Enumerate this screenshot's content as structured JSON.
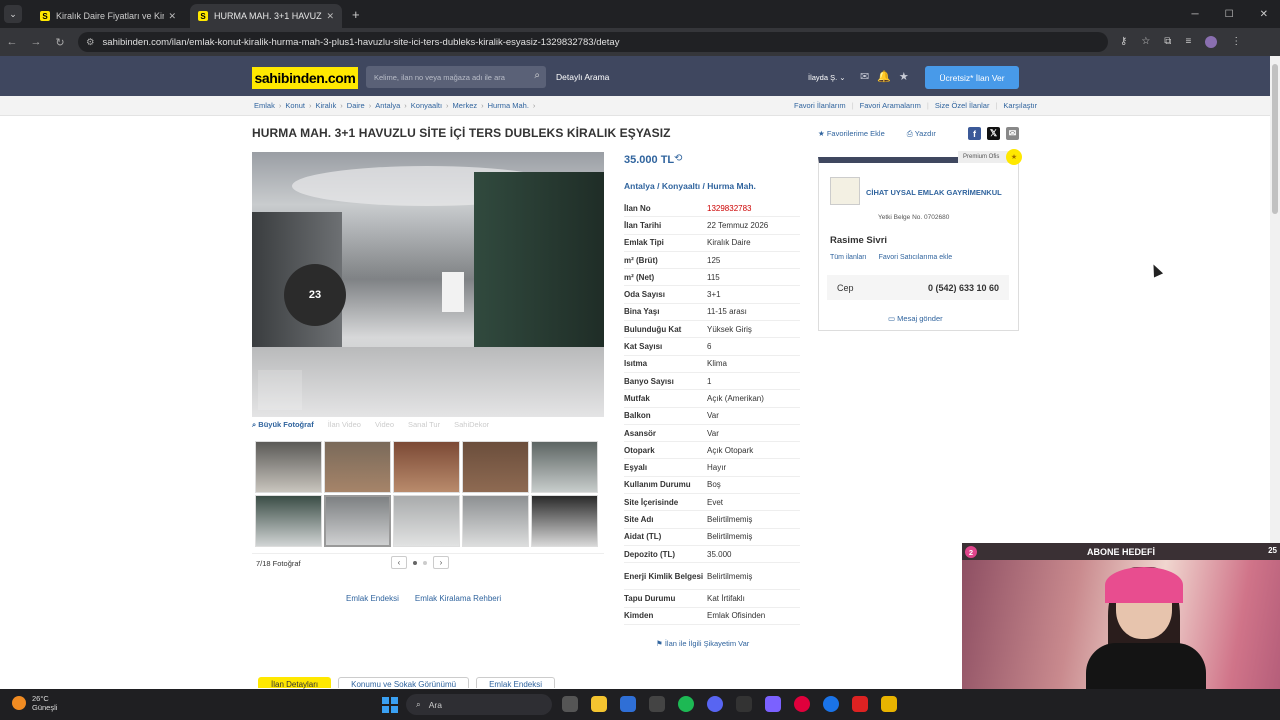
{
  "browser": {
    "tabs": [
      {
        "title": "Kiralık Daire Fiyatları ve Kiralık E",
        "favicon": "S"
      },
      {
        "title": "HURMA MAH. 3+1 HAVUZLU SİTE",
        "favicon": "S"
      }
    ],
    "url": "sahibinden.com/ilan/emlak-konut-kiralik-hurma-mah-3-plus1-havuzlu-site-ici-ters-dubleks-kiralik-esyasiz-1329832783/detay"
  },
  "header": {
    "logo": "sahibinden.com",
    "search_placeholder": "Kelime, ilan no veya mağaza adı ile ara",
    "advanced_search": "Detaylı Arama",
    "user": "İlayda Ş.",
    "post_button": "Ücretsiz* İlan Ver"
  },
  "breadcrumb": [
    "Emlak",
    "Konut",
    "Kiralık",
    "Daire",
    "Antalya",
    "Konyaaltı",
    "Merkez",
    "Hurma Mah."
  ],
  "breadcrumb_right": [
    "Favori İlanlarım",
    "Favori Aramalarım",
    "Size Özel İlanlar",
    "Karşılaştır"
  ],
  "listing": {
    "title": "HURMA MAH. 3+1 HAVUZLU SİTE İÇİ TERS DUBLEKS KİRALIK EŞYASIZ",
    "add_favorite": "Favorilerime Ekle",
    "print": "Yazdır",
    "price": "35.000 TL",
    "location": [
      "Antalya",
      "Konyaaltı",
      "Hurma Mah."
    ],
    "location_sep": "/",
    "details": [
      {
        "k": "İlan No",
        "v": "1329832783"
      },
      {
        "k": "İlan Tarihi",
        "v": "22 Temmuz 2026"
      },
      {
        "k": "Emlak Tipi",
        "v": "Kiralık Daire"
      },
      {
        "k": "m² (Brüt)",
        "v": "125"
      },
      {
        "k": "m² (Net)",
        "v": "115"
      },
      {
        "k": "Oda Sayısı",
        "v": "3+1"
      },
      {
        "k": "Bina Yaşı",
        "v": "11-15 arası"
      },
      {
        "k": "Bulunduğu Kat",
        "v": "Yüksek Giriş"
      },
      {
        "k": "Kat Sayısı",
        "v": "6"
      },
      {
        "k": "Isıtma",
        "v": "Klima"
      },
      {
        "k": "Banyo Sayısı",
        "v": "1"
      },
      {
        "k": "Mutfak",
        "v": "Açık (Amerikan)"
      },
      {
        "k": "Balkon",
        "v": "Var"
      },
      {
        "k": "Asansör",
        "v": "Var"
      },
      {
        "k": "Otopark",
        "v": "Açık Otopark"
      },
      {
        "k": "Eşyalı",
        "v": "Hayır"
      },
      {
        "k": "Kullanım Durumu",
        "v": "Boş"
      },
      {
        "k": "Site İçerisinde",
        "v": "Evet"
      },
      {
        "k": "Site Adı",
        "v": "Belirtilmemiş"
      },
      {
        "k": "Aidat (TL)",
        "v": "Belirtilmemiş"
      },
      {
        "k": "Depozito (TL)",
        "v": "35.000"
      },
      {
        "k": "Enerji Kimlik Belgesi",
        "v": "Belirtilmemiş"
      },
      {
        "k": "Tapu Durumu",
        "v": "Kat İrtifaklı"
      },
      {
        "k": "Kimden",
        "v": "Emlak Ofisinden"
      }
    ],
    "complaint": "İlan ile İlgili Şikayetim Var"
  },
  "gallery": {
    "big_photo": "Büyük Fotoğraf",
    "options": [
      "İlan Video",
      "Video",
      "Sanal Tur",
      "SahiDekor"
    ],
    "count": "7/18 Fotoğraf",
    "photo_sign": "23"
  },
  "bottom_links": [
    "Emlak Endeksi",
    "Emlak Kiralama Rehberi"
  ],
  "bottom_tabs": [
    "İlan Detayları",
    "Konumu ve Sokak Görünümü",
    "Emlak Endeksi"
  ],
  "seller": {
    "badge": "Premium Ofis",
    "company": "CİHAT UYSAL EMLAK GAYRİMENKUL",
    "license": "Yetki Belge No.  0702680",
    "person": "Rasime Sivri",
    "links": [
      "Tüm ilanları",
      "Favori Satıcılarıma ekle"
    ],
    "phone_label": "Cep",
    "phone": "0 (542) 633 10 60",
    "message": "Mesaj gönder"
  },
  "overlay": {
    "title": "ABONE HEDEFİ",
    "left": "2",
    "right": "25"
  },
  "taskbar": {
    "temp": "26°C",
    "weather": "Güneşli",
    "search": "Ara"
  }
}
